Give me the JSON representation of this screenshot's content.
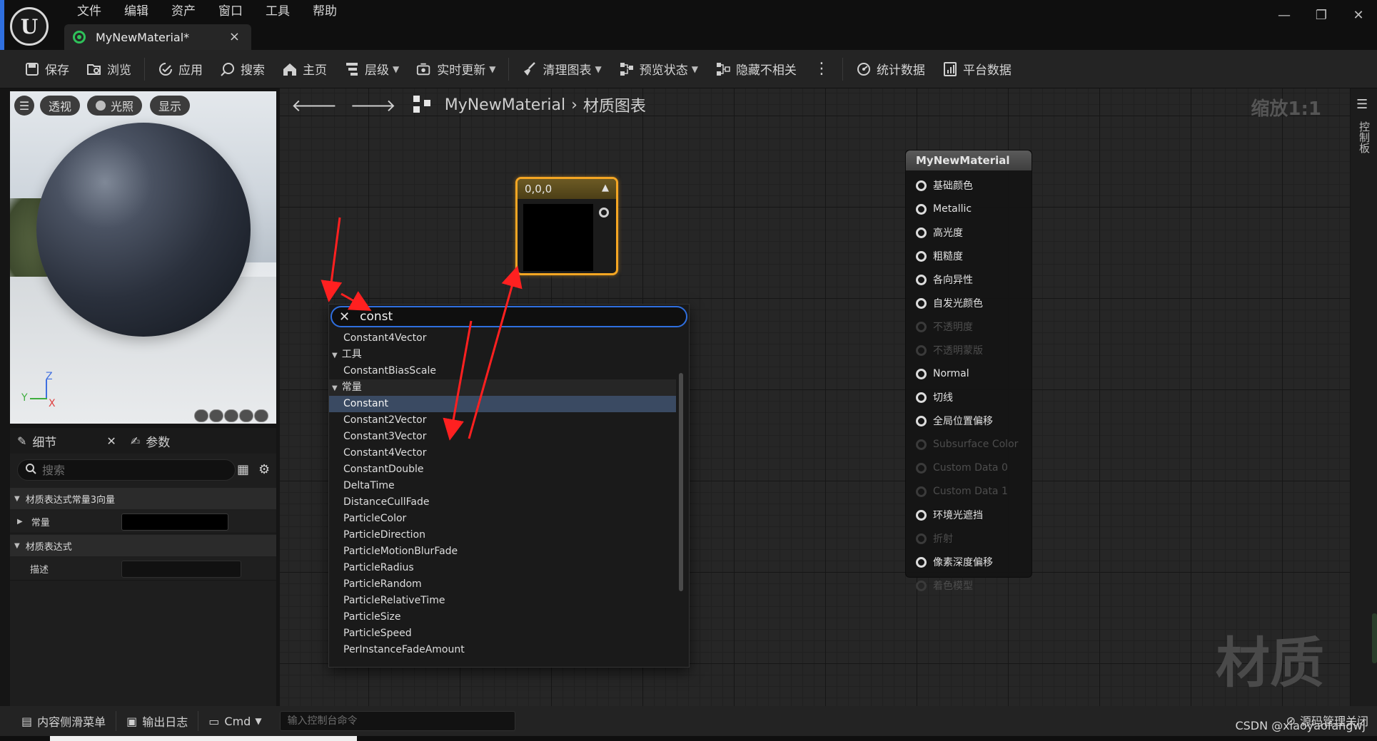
{
  "menu": [
    "文件",
    "编辑",
    "资产",
    "窗口",
    "工具",
    "帮助"
  ],
  "tab": {
    "title": "MyNewMaterial*",
    "close": "×"
  },
  "window_controls": {
    "minimize": "—",
    "restore": "❐",
    "close": "✕"
  },
  "toolbar": {
    "save": "保存",
    "browse": "浏览",
    "apply": "应用",
    "search": "搜索",
    "home": "主页",
    "hierarchy": "层级",
    "live_update": "实时更新",
    "clean_graph": "清理图表",
    "preview_state": "预览状态",
    "hide_unrelated": "隐藏不相关",
    "stats": "统计数据",
    "platform_stats": "平台数据"
  },
  "viewport": {
    "perspective": "透视",
    "lighting": "光照",
    "show": "显示",
    "axis_z": "Z",
    "axis_y": "Y",
    "axis_x": "X"
  },
  "details": {
    "tab_details": "细节",
    "tab_params": "参数",
    "search_placeholder": "搜索",
    "category_vector": "材质表达式常量3向量",
    "prop_constant": "常量",
    "category_expression": "材质表达式",
    "prop_desc": "描述"
  },
  "graph": {
    "breadcrumb_material": "MyNewMaterial",
    "breadcrumb_graph": "材质图表",
    "zoom": "缩放1:1",
    "watermark": "材质"
  },
  "constant_node": {
    "title": "0,0,0"
  },
  "material_node": {
    "title": "MyNewMaterial",
    "pins": [
      {
        "label": "基础颜色",
        "enabled": true
      },
      {
        "label": "Metallic",
        "enabled": true
      },
      {
        "label": "高光度",
        "enabled": true
      },
      {
        "label": "粗糙度",
        "enabled": true
      },
      {
        "label": "各向异性",
        "enabled": true
      },
      {
        "label": "自发光颜色",
        "enabled": true
      },
      {
        "label": "不透明度",
        "enabled": false
      },
      {
        "label": "不透明蒙版",
        "enabled": false
      },
      {
        "label": "Normal",
        "enabled": true
      },
      {
        "label": "切线",
        "enabled": true
      },
      {
        "label": "全局位置偏移",
        "enabled": true
      },
      {
        "label": "Subsurface Color",
        "enabled": false
      },
      {
        "label": "Custom Data 0",
        "enabled": false
      },
      {
        "label": "Custom Data 1",
        "enabled": false
      },
      {
        "label": "环境光遮挡",
        "enabled": true
      },
      {
        "label": "折射",
        "enabled": false
      },
      {
        "label": "像素深度偏移",
        "enabled": true
      },
      {
        "label": "着色模型",
        "enabled": false
      }
    ]
  },
  "search_popup": {
    "query": "const",
    "items": [
      {
        "label": "Constant4Vector",
        "kind": "item"
      },
      {
        "label": "工具",
        "kind": "category-plain"
      },
      {
        "label": "ConstantBiasScale",
        "kind": "item"
      },
      {
        "label": "常量",
        "kind": "category"
      },
      {
        "label": "Constant",
        "kind": "selected"
      },
      {
        "label": "Constant2Vector",
        "kind": "item"
      },
      {
        "label": "Constant3Vector",
        "kind": "item"
      },
      {
        "label": "Constant4Vector",
        "kind": "item"
      },
      {
        "label": "ConstantDouble",
        "kind": "item"
      },
      {
        "label": "DeltaTime",
        "kind": "item"
      },
      {
        "label": "DistanceCullFade",
        "kind": "item"
      },
      {
        "label": "ParticleColor",
        "kind": "item"
      },
      {
        "label": "ParticleDirection",
        "kind": "item"
      },
      {
        "label": "ParticleMotionBlurFade",
        "kind": "item"
      },
      {
        "label": "ParticleRadius",
        "kind": "item"
      },
      {
        "label": "ParticleRandom",
        "kind": "item"
      },
      {
        "label": "ParticleRelativeTime",
        "kind": "item"
      },
      {
        "label": "ParticleSize",
        "kind": "item"
      },
      {
        "label": "ParticleSpeed",
        "kind": "item"
      },
      {
        "label": "PerInstanceFadeAmount",
        "kind": "item"
      }
    ]
  },
  "right_panel": {
    "label": "控制板"
  },
  "status": {
    "content_drawer": "内容侧滑菜单",
    "output_log": "输出日志",
    "cmd": "Cmd",
    "console_placeholder": "输入控制台命令",
    "source_control": "源码管理关闭"
  },
  "watermark_credit": "CSDN @xiaoyaofangwj",
  "colors": {
    "accent_blue": "#2f6fdf",
    "node_highlight": "#f5a623",
    "arrow": "#ff2020"
  }
}
